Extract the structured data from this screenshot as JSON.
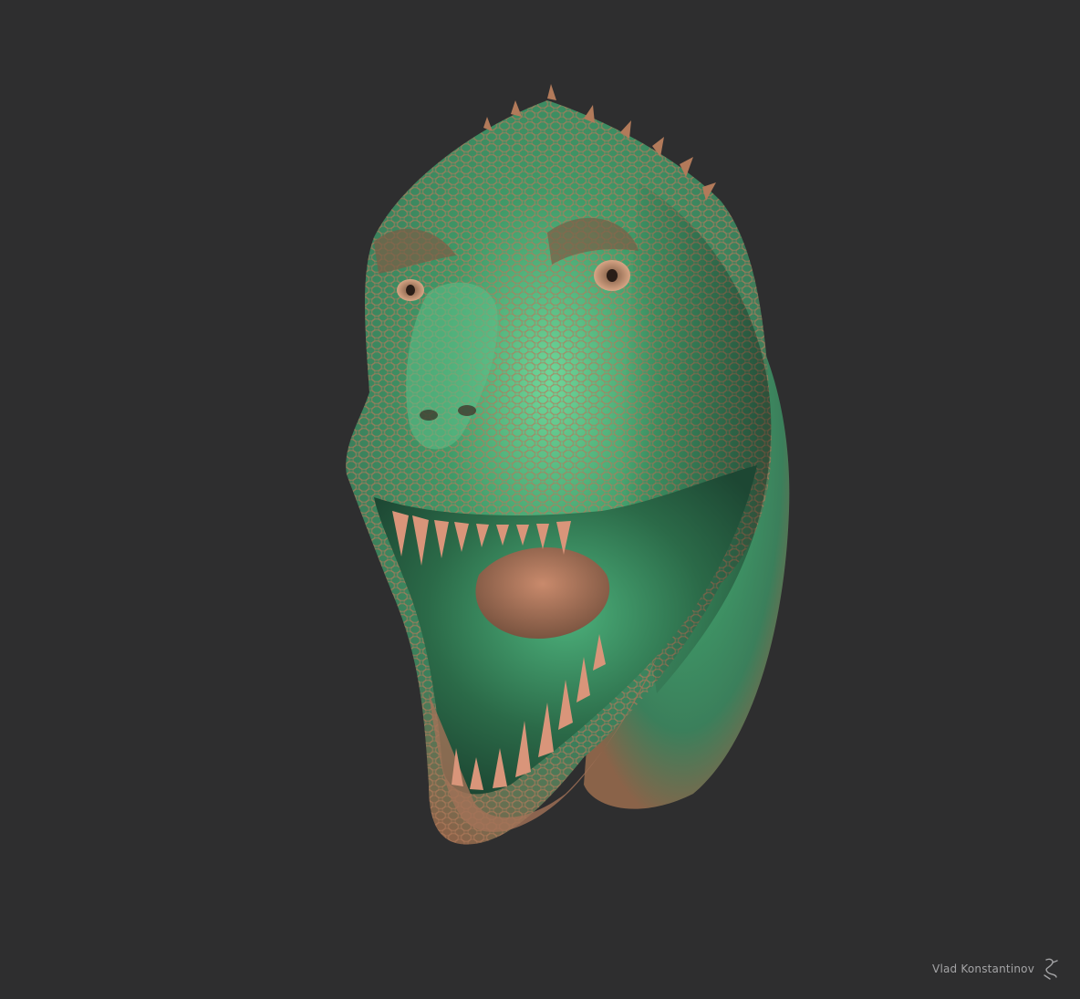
{
  "artwork": {
    "subject_icon": "dinosaur-head-icon",
    "colors": {
      "background": "#2e2e2f",
      "skin_green": "#3f9a68",
      "skin_highlight": "#6fd79a",
      "skin_copper": "#b27a5a",
      "mouth_dark": "#2b6a48",
      "teeth": "#d9957a"
    }
  },
  "signature": {
    "author": "Vlad Konstantinov",
    "mark_icon": "artist-monogram-icon"
  }
}
